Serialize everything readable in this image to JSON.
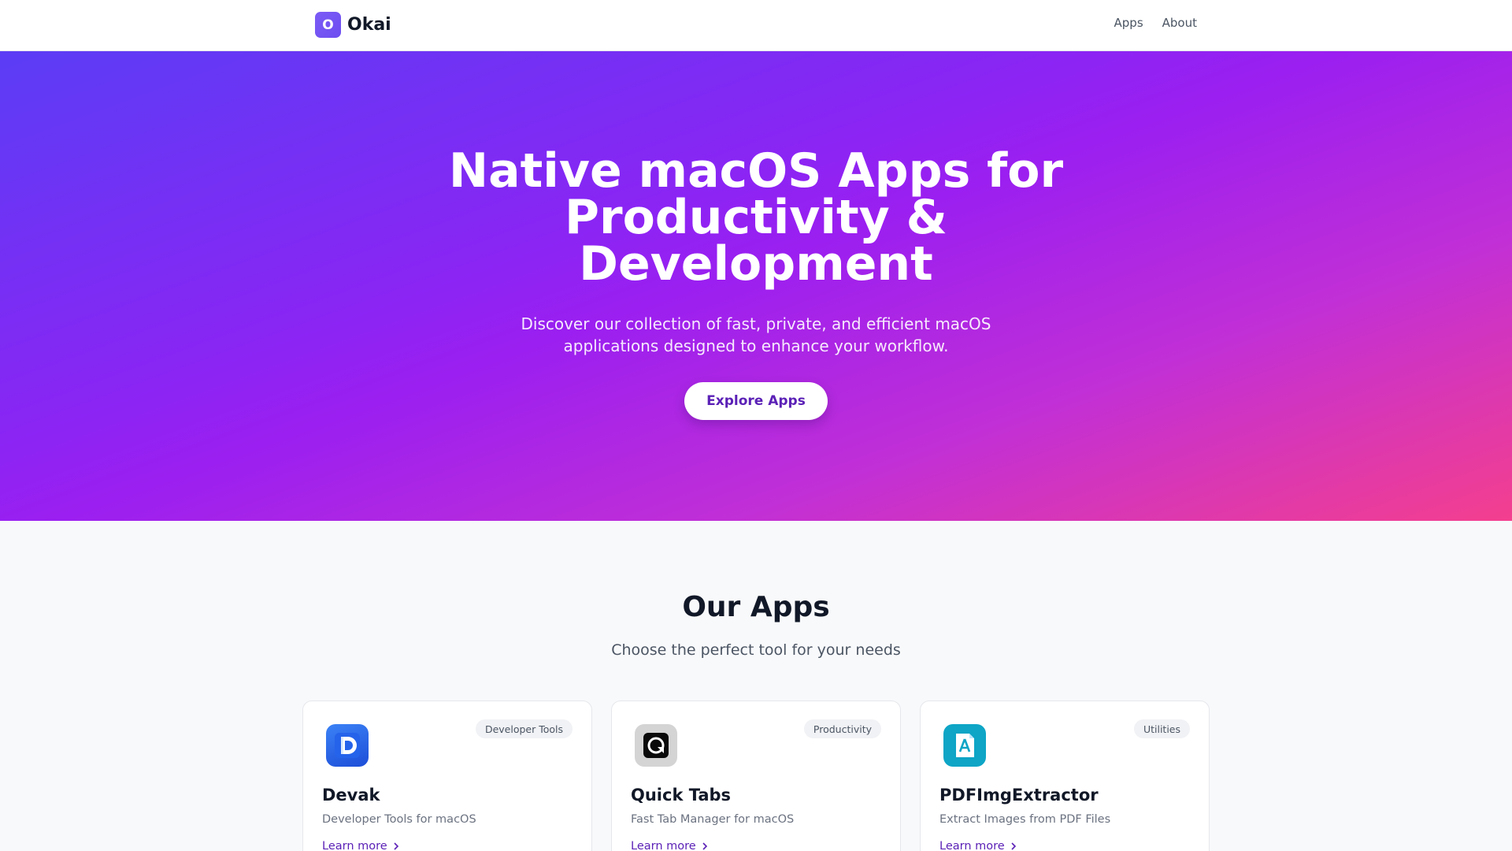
{
  "header": {
    "logo_letter": "O",
    "brand": "Okai",
    "nav": [
      {
        "label": "Apps"
      },
      {
        "label": "About"
      }
    ]
  },
  "hero": {
    "title": "Native macOS Apps for Productivity & Development",
    "subtitle": "Discover our collection of fast, private, and efficient macOS applications designed to enhance your workflow.",
    "cta": "Explore Apps"
  },
  "apps": {
    "title": "Our Apps",
    "subtitle": "Choose the perfect tool for your needs",
    "cards": [
      {
        "name": "Devak",
        "category": "Developer Tools",
        "description": "Developer Tools for macOS",
        "link": "Learn more",
        "icon": "devak-app-icon"
      },
      {
        "name": "Quick Tabs",
        "category": "Productivity",
        "description": "Fast Tab Manager for macOS",
        "link": "Learn more",
        "icon": "quick-tabs-app-icon"
      },
      {
        "name": "PDFImgExtractor",
        "category": "Utilities",
        "description": "Extract Images from PDF Files",
        "link": "Learn more",
        "icon": "pdf-img-extractor-app-icon"
      }
    ]
  },
  "colors": {
    "accent": "#5b21b6",
    "hero_start": "#5b3df5",
    "hero_end": "#f43f8e"
  }
}
